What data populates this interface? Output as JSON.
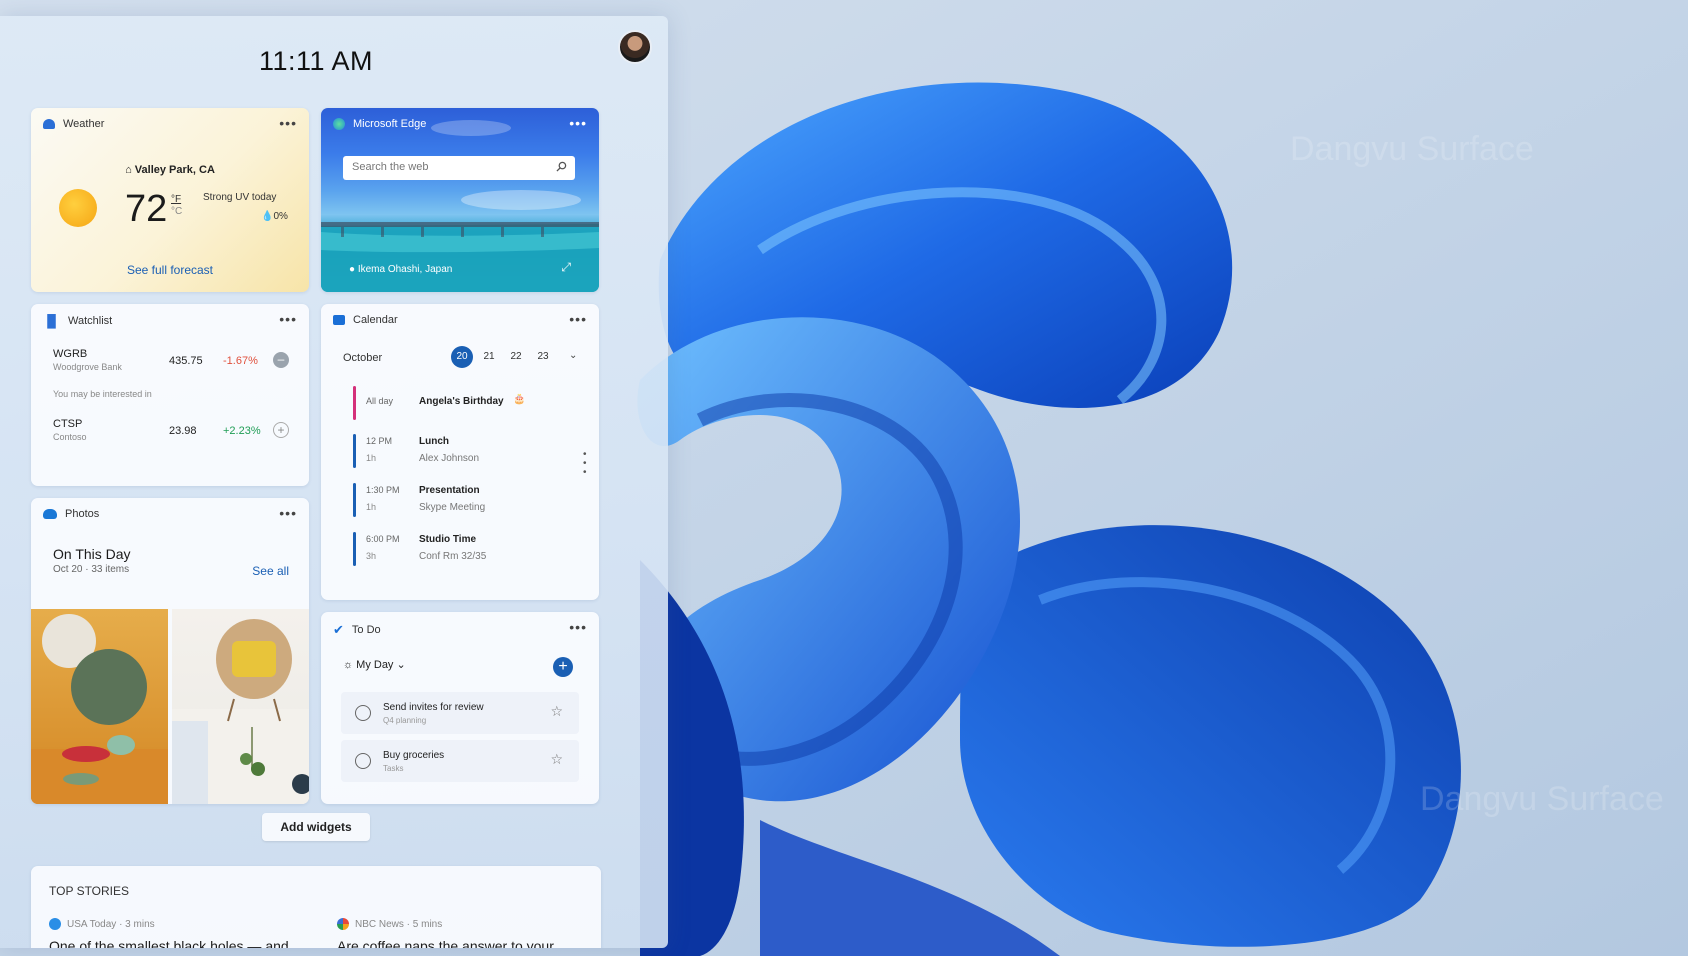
{
  "clock": "11:11 AM",
  "weather": {
    "header": "Weather",
    "location": "Valley Park, CA",
    "temp": "72",
    "unit_f": "°F",
    "unit_c": "°C",
    "condition": "Strong UV today",
    "precip": "0%",
    "link": "See full forecast"
  },
  "edge": {
    "header": "Microsoft Edge",
    "search_placeholder": "Search the web",
    "location": "Ikema Ohashi, Japan"
  },
  "watchlist": {
    "header": "Watchlist",
    "stocks": [
      {
        "symbol": "WGRB",
        "company": "Woodgrove Bank",
        "price": "435.75",
        "change": "-1.67%"
      },
      {
        "symbol": "CTSP",
        "company": "Contoso",
        "price": "23.98",
        "change": "+2.23%"
      }
    ],
    "hint": "You may be interested in"
  },
  "photos": {
    "header": "Photos",
    "title": "On This Day",
    "subtitle": "Oct 20 · 33 items",
    "see_all": "See all"
  },
  "calendar": {
    "header": "Calendar",
    "month": "October",
    "days": [
      "20",
      "21",
      "22",
      "23"
    ],
    "events": [
      {
        "time": "All day",
        "duration": "",
        "title": "Angela's Birthday",
        "subtitle": "",
        "color": "#d4307a"
      },
      {
        "time": "12 PM",
        "duration": "1h",
        "title": "Lunch",
        "subtitle": "Alex Johnson",
        "color": "#1a5fb4"
      },
      {
        "time": "1:30 PM",
        "duration": "1h",
        "title": "Presentation",
        "subtitle": "Skype Meeting",
        "color": "#1a5fb4"
      },
      {
        "time": "6:00 PM",
        "duration": "3h",
        "title": "Studio Time",
        "subtitle": "Conf Rm 32/35",
        "color": "#1a5fb4"
      }
    ]
  },
  "todo": {
    "header": "To Do",
    "list": "My Day",
    "tasks": [
      {
        "title": "Send invites for review",
        "subtitle": "Q4 planning"
      },
      {
        "title": "Buy groceries",
        "subtitle": "Tasks"
      }
    ]
  },
  "add_widgets": "Add widgets",
  "stories": {
    "header": "TOP STORIES",
    "items": [
      {
        "source": "USA Today · 3 mins",
        "headline": "One of the smallest black holes — and"
      },
      {
        "source": "NBC News · 5 mins",
        "headline": "Are coffee naps the answer to your"
      }
    ]
  },
  "watermark": "Dangvu Surface",
  "colors": {
    "accent": "#1a5fb4",
    "negative": "#e0503c",
    "positive": "#1f9d55"
  }
}
